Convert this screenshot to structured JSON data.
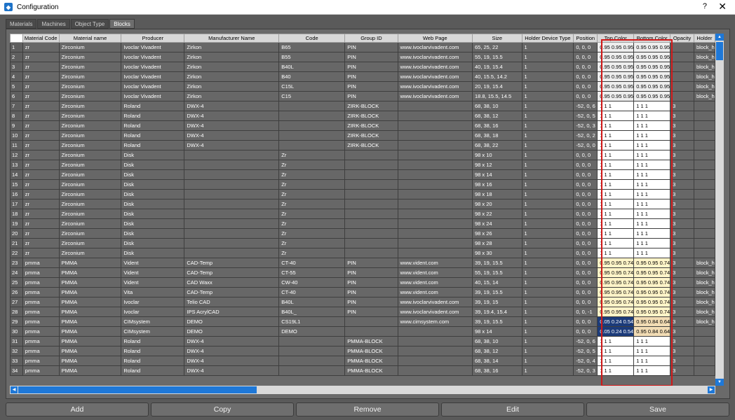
{
  "window": {
    "title": "Configuration",
    "help": "?",
    "close": "✕"
  },
  "tabs": [
    {
      "label": "Materials",
      "active": false
    },
    {
      "label": "Machines",
      "active": false
    },
    {
      "label": "Object Type",
      "active": false
    },
    {
      "label": "Blocks",
      "active": true
    }
  ],
  "grid": {
    "columns": [
      "Material Code",
      "Material name",
      "Producer",
      "Manufacturer Name",
      "Code",
      "Group ID",
      "Web Page",
      "Size",
      "Holder Device Type",
      "Position",
      "Top Color",
      "Bottom Color",
      "Opacity",
      "Holder"
    ],
    "rows": [
      [
        "1",
        "zr",
        "Zirconium",
        "Ivoclar Vivadent",
        "Zirkon",
        "B65",
        "PIN",
        "www.ivoclarvivadent.com",
        "65, 25, 22",
        "1",
        "0, 0, 0",
        "0.95 0.95 0.95",
        "0.95 0.95 0.95",
        "",
        "block_h"
      ],
      [
        "2",
        "zr",
        "Zirconium",
        "Ivoclar Vivadent",
        "Zirkon",
        "B55",
        "PIN",
        "www.ivoclarvivadent.com",
        "55, 19, 15.5",
        "1",
        "0, 0, 0",
        "0.95 0.95 0.95",
        "0.95 0.95 0.95",
        "",
        "block_h"
      ],
      [
        "3",
        "zr",
        "Zirconium",
        "Ivoclar Vivadent",
        "Zirkon",
        "B40L",
        "PIN",
        "www.ivoclarvivadent.com",
        "40, 19, 15.4",
        "1",
        "0, 0, 0",
        "0.95 0.95 0.95",
        "0.95 0.95 0.95",
        "",
        "block_h"
      ],
      [
        "4",
        "zr",
        "Zirconium",
        "Ivoclar Vivadent",
        "Zirkon",
        "B40",
        "PIN",
        "www.ivoclarvivadent.com",
        "40, 15.5, 14.2",
        "1",
        "0, 0, 0",
        "0.95 0.95 0.95",
        "0.95 0.95 0.95",
        "",
        "block_h"
      ],
      [
        "5",
        "zr",
        "Zirconium",
        "Ivoclar Vivadent",
        "Zirkon",
        "C15L",
        "PIN",
        "www.ivoclarvivadent.com",
        "20, 19, 15.4",
        "1",
        "0, 0, 0",
        "0.95 0.95 0.95",
        "0.95 0.95 0.95",
        "",
        "block_h"
      ],
      [
        "6",
        "zr",
        "Zirconium",
        "Ivoclar Vivadent",
        "Zirkon",
        "C15",
        "PIN",
        "www.ivoclarvivadent.com",
        "18.8, 15.5, 14.5",
        "1",
        "0, 0, 0",
        "0.95 0.95 0.95",
        "0.95 0.95 0.95",
        "",
        "block_h"
      ],
      [
        "7",
        "zr",
        "Zirconium",
        "Roland",
        "DWX-4",
        "",
        "ZIRK-BLOCK",
        "",
        "68, 38, 10",
        "1",
        "-52, 0, 6",
        "1 1 1",
        "1 1 1",
        "3",
        ""
      ],
      [
        "8",
        "zr",
        "Zirconium",
        "Roland",
        "DWX-4",
        "",
        "ZIRK-BLOCK",
        "",
        "68, 38, 12",
        "1",
        "-52, 0, 5",
        "1 1 1",
        "1 1 1",
        "3",
        ""
      ],
      [
        "9",
        "zr",
        "Zirconium",
        "Roland",
        "DWX-4",
        "",
        "ZIRK-BLOCK",
        "",
        "68, 38, 16",
        "1",
        "-52, 0, 3",
        "1 1 1",
        "1 1 1",
        "3",
        ""
      ],
      [
        "10",
        "zr",
        "Zirconium",
        "Roland",
        "DWX-4",
        "",
        "ZIRK-BLOCK",
        "",
        "68, 38, 18",
        "1",
        "-52, 0, 2",
        "1 1 1",
        "1 1 1",
        "3",
        ""
      ],
      [
        "11",
        "zr",
        "Zirconium",
        "Roland",
        "DWX-4",
        "",
        "ZIRK-BLOCK",
        "",
        "68, 38, 22",
        "1",
        "-52, 0, 0",
        "1 1 1",
        "1 1 1",
        "3",
        ""
      ],
      [
        "12",
        "zr",
        "Zirconium",
        "Disk",
        "",
        "Zr",
        "",
        "",
        "98 x 10",
        "1",
        "0, 0, 0",
        "1 1 1",
        "1 1 1",
        "3",
        ""
      ],
      [
        "13",
        "zr",
        "Zirconium",
        "Disk",
        "",
        "Zr",
        "",
        "",
        "98 x 12",
        "1",
        "0, 0, 0",
        "1 1 1",
        "1 1 1",
        "3",
        ""
      ],
      [
        "14",
        "zr",
        "Zirconium",
        "Disk",
        "",
        "Zr",
        "",
        "",
        "98 x 14",
        "1",
        "0, 0, 0",
        "1 1 1",
        "1 1 1",
        "3",
        ""
      ],
      [
        "15",
        "zr",
        "Zirconium",
        "Disk",
        "",
        "Zr",
        "",
        "",
        "98 x 16",
        "1",
        "0, 0, 0",
        "1 1 1",
        "1 1 1",
        "3",
        ""
      ],
      [
        "16",
        "zr",
        "Zirconium",
        "Disk",
        "",
        "Zr",
        "",
        "",
        "98 x 18",
        "1",
        "0, 0, 0",
        "1 1 1",
        "1 1 1",
        "3",
        ""
      ],
      [
        "17",
        "zr",
        "Zirconium",
        "Disk",
        "",
        "Zr",
        "",
        "",
        "98 x 20",
        "1",
        "0, 0, 0",
        "1 1 1",
        "1 1 1",
        "3",
        ""
      ],
      [
        "18",
        "zr",
        "Zirconium",
        "Disk",
        "",
        "Zr",
        "",
        "",
        "98 x 22",
        "1",
        "0, 0, 0",
        "1 1 1",
        "1 1 1",
        "3",
        ""
      ],
      [
        "19",
        "zr",
        "Zirconium",
        "Disk",
        "",
        "Zr",
        "",
        "",
        "98 x 24",
        "1",
        "0, 0, 0",
        "1 1 1",
        "1 1 1",
        "3",
        ""
      ],
      [
        "20",
        "zr",
        "Zirconium",
        "Disk",
        "",
        "Zr",
        "",
        "",
        "98 x 26",
        "1",
        "0, 0, 0",
        "1 1 1",
        "1 1 1",
        "3",
        ""
      ],
      [
        "21",
        "zr",
        "Zirconium",
        "Disk",
        "",
        "Zr",
        "",
        "",
        "98 x 28",
        "1",
        "0, 0, 0",
        "1 1 1",
        "1 1 1",
        "3",
        ""
      ],
      [
        "22",
        "zr",
        "Zirconium",
        "Disk",
        "",
        "Zr",
        "",
        "",
        "98 x 30",
        "1",
        "0, 0, 0",
        "1 1 1",
        "1 1 1",
        "3",
        ""
      ],
      [
        "23",
        "pmma",
        "PMMA",
        "Vident",
        "CAD-Temp",
        "CT-40",
        "PIN",
        "www.vident.com",
        "39, 19, 15.5",
        "1",
        "0, 0, 0",
        "0.95 0.95 0.74",
        "0.95 0.95 0.74",
        "3",
        "block_h"
      ],
      [
        "24",
        "pmma",
        "PMMA",
        "Vident",
        "CAD-Temp",
        "CT-55",
        "PIN",
        "www.vident.com",
        "55, 19, 15.5",
        "1",
        "0, 0, 0",
        "0.95 0.95 0.74",
        "0.95 0.95 0.74",
        "3",
        "block_h"
      ],
      [
        "25",
        "pmma",
        "PMMA",
        "Vident",
        "CAD Waxx",
        "CW-40",
        "PIN",
        "www.vident.com",
        "40, 15, 14",
        "1",
        "0, 0, 0",
        "0.95 0.95 0.74",
        "0.95 0.95 0.74",
        "3",
        "block_h"
      ],
      [
        "26",
        "pmma",
        "PMMA",
        "Vita",
        "CAD-Temp",
        "CT-40",
        "PIN",
        "www.vident.com",
        "39, 19, 15.5",
        "1",
        "0, 0, 0",
        "0.95 0.95 0.74",
        "0.95 0.95 0.74",
        "3",
        "block_h"
      ],
      [
        "27",
        "pmma",
        "PMMA",
        "Ivoclar",
        "Telio CAD",
        "B40L",
        "PIN",
        "www.ivoclarvivadent.com",
        "39, 19, 15",
        "1",
        "0, 0, 0",
        "0.95 0.95 0.74",
        "0.95 0.95 0.74",
        "3",
        "block_h"
      ],
      [
        "28",
        "pmma",
        "PMMA",
        "Ivoclar",
        "IPS AcrylCAD",
        "B40L_",
        "PIN",
        "www.ivoclarvivadent.com",
        "39, 19.4, 15.4",
        "1",
        "0, 0, -1",
        "0.95 0.95 0.74",
        "0.95 0.95 0.74",
        "3",
        "block_h"
      ],
      [
        "29",
        "pmma",
        "PMMA",
        "CIMsystem",
        "DEMO",
        "CS19L1",
        "",
        "www.cimsystem.com",
        "39, 19, 15.5",
        "1",
        "0, 0, 0",
        "0.05 0.24 0.54",
        "0.95 0.84 0.64",
        "3",
        "block_h"
      ],
      [
        "30",
        "pmma",
        "PMMA",
        "CIMsystem",
        "DEMO",
        "DEMO",
        "",
        "",
        "98 x 14",
        "1",
        "0, 0, 0",
        "0.05 0.24 0.54",
        "0.95 0.84 0.64",
        "3",
        ""
      ],
      [
        "31",
        "pmma",
        "PMMA",
        "Roland",
        "DWX-4",
        "",
        "PMMA-BLOCK",
        "",
        "68, 38, 10",
        "1",
        "-52, 0, 6",
        "1 1 1",
        "1 1 1",
        "3",
        ""
      ],
      [
        "32",
        "pmma",
        "PMMA",
        "Roland",
        "DWX-4",
        "",
        "PMMA-BLOCK",
        "",
        "68, 38, 12",
        "1",
        "-52, 0, 5",
        "1 1 1",
        "1 1 1",
        "3",
        ""
      ],
      [
        "33",
        "pmma",
        "PMMA",
        "Roland",
        "DWX-4",
        "",
        "PMMA-BLOCK",
        "",
        "68, 38, 14",
        "1",
        "-52, 0, 4",
        "1 1 1",
        "1 1 1",
        "3",
        ""
      ],
      [
        "34",
        "pmma",
        "PMMA",
        "Roland",
        "DWX-4",
        "",
        "PMMA-BLOCK",
        "",
        "68, 38, 16",
        "1",
        "-52, 0, 3",
        "1 1 1",
        "1 1 1",
        "3",
        ""
      ]
    ]
  },
  "buttons": {
    "add": "Add",
    "copy": "Copy",
    "remove": "Remove",
    "edit": "Edit",
    "save": "Save"
  },
  "colors": {
    "accent": "#1e78d8",
    "highlight": "#d01818"
  }
}
